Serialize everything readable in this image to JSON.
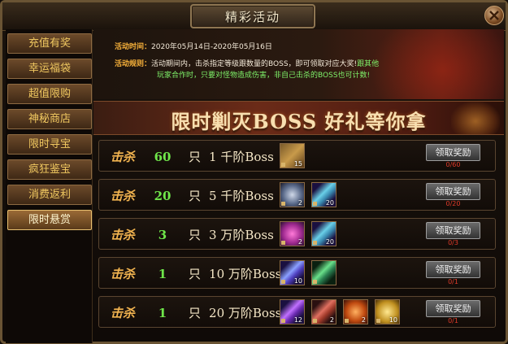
{
  "window": {
    "title": "精彩活动"
  },
  "sidebar": {
    "items": [
      {
        "label": "充值有奖"
      },
      {
        "label": "幸运福袋"
      },
      {
        "label": "超值限购"
      },
      {
        "label": "神秘商店"
      },
      {
        "label": "限时寻宝"
      },
      {
        "label": "疯狂鉴宝"
      },
      {
        "label": "消费返利"
      },
      {
        "label": "限时悬赏"
      }
    ],
    "active_index": 7
  },
  "activity": {
    "time_label": "活动时间：",
    "time_value": "2020年05月14日-2020年05月16日",
    "rule_label": "活动规则：",
    "rule_value_white": "活动期间内，击杀指定等级跟数量的BOSS，即可领取对应大奖!",
    "rule_value_green": "跟其他",
    "rule_value_line2": "玩家合作时，只要对怪物造成伤害，非自己击杀的BOSS也可计数!"
  },
  "slogan": "限时剿灭BOSS   好礼等你拿",
  "rows": [
    {
      "kill": "击杀",
      "count": "60",
      "unit": "只",
      "boss": "1  千阶Boss",
      "button": "领取奖励",
      "progress": "0/60",
      "items": [
        {
          "icon": "treasure-chest-icon",
          "count": "15"
        }
      ]
    },
    {
      "kill": "击杀",
      "count": "20",
      "unit": "只",
      "boss": "5  千阶Boss",
      "button": "领取奖励",
      "progress": "0/20",
      "items": [
        {
          "icon": "compass-orb-icon",
          "count": "2"
        },
        {
          "icon": "crystal-shard-icon",
          "count": "20"
        }
      ]
    },
    {
      "kill": "击杀",
      "count": "3",
      "unit": "只",
      "boss": "3  万阶Boss",
      "button": "领取奖励",
      "progress": "0/3",
      "items": [
        {
          "icon": "pink-gem-icon",
          "count": "2"
        },
        {
          "icon": "crystal-shard-icon",
          "count": "20"
        }
      ]
    },
    {
      "kill": "击杀",
      "count": "1",
      "unit": "只",
      "boss": "10  万阶Boss",
      "button": "领取奖励",
      "progress": "0/1",
      "items": [
        {
          "icon": "blue-feather-icon",
          "count": "10"
        },
        {
          "icon": "green-crystal-icon",
          "count": ""
        }
      ]
    },
    {
      "kill": "击杀",
      "count": "1",
      "unit": "只",
      "boss": "20  万阶Boss",
      "button": "领取奖励",
      "progress": "0/1",
      "items": [
        {
          "icon": "purple-feather-icon",
          "count": "12"
        },
        {
          "icon": "red-feather-icon",
          "count": "2"
        },
        {
          "icon": "fire-orb-icon",
          "count": "2"
        },
        {
          "icon": "gold-coin-icon",
          "count": "10"
        }
      ]
    }
  ],
  "colors": {
    "accent": "#f7b13a",
    "green": "#6fe64a",
    "progress_red": "#e03a2a"
  }
}
